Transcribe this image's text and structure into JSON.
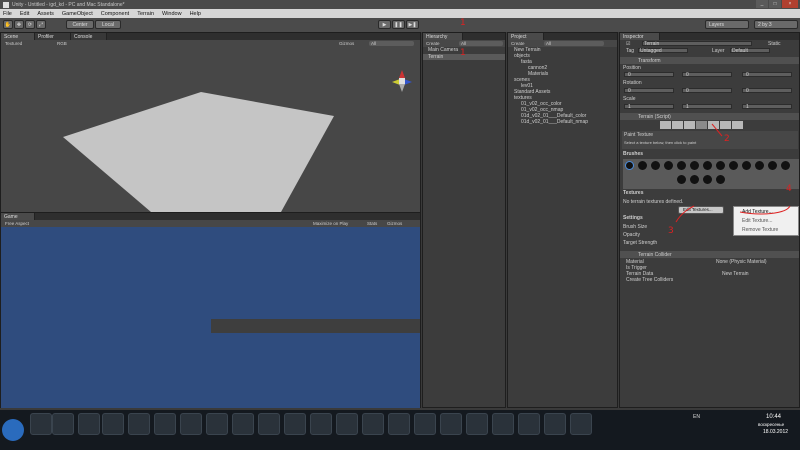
{
  "window": {
    "title": "Unity - Untitled - igd_kd - PC and Mac Standalone*",
    "controls": [
      "_",
      "□",
      "×"
    ]
  },
  "menubar": [
    "File",
    "Edit",
    "Assets",
    "GameObject",
    "Component",
    "Terrain",
    "Window",
    "Help"
  ],
  "toolbar": {
    "pivot_label": "Center",
    "space_label": "Local",
    "play_icons": [
      "▶",
      "❚❚",
      "▶❚"
    ],
    "layers_label": "Layers",
    "layout_label": "2 by 3"
  },
  "scene": {
    "tab": "Scene",
    "tab2": "Profiler",
    "tab3": "Console",
    "render_mode": "Textured",
    "color_mode": "RGB",
    "gizmos": "Gizmos",
    "search": "All"
  },
  "game": {
    "tab": "Game",
    "aspect": "Free Aspect",
    "maximize": "Maximize on Play",
    "stats": "Stats",
    "gizmos": "Gizmos"
  },
  "hierarchy": {
    "tab": "Hierarchy",
    "create": "Create",
    "search": "All",
    "items": [
      "Main Camera",
      "Terrain"
    ]
  },
  "project": {
    "tab": "Project",
    "create": "Create",
    "search": "All",
    "items": [
      {
        "label": "New Terrain",
        "indent": 0
      },
      {
        "label": "objects",
        "indent": 0
      },
      {
        "label": "fasta",
        "indent": 1
      },
      {
        "label": "cannon2",
        "indent": 2
      },
      {
        "label": "Materials",
        "indent": 2
      },
      {
        "label": "scenes",
        "indent": 0
      },
      {
        "label": "lev01",
        "indent": 1
      },
      {
        "label": "Standard Assets",
        "indent": 0
      },
      {
        "label": "textures",
        "indent": 0
      },
      {
        "label": "01_v02_occ_color",
        "indent": 1
      },
      {
        "label": "01_v02_occ_nmap",
        "indent": 1
      },
      {
        "label": "01d_v02_01___Default_color",
        "indent": 1
      },
      {
        "label": "01d_v02_01___Default_nmap",
        "indent": 1
      }
    ]
  },
  "inspector": {
    "tab": "Inspector",
    "object_name": "Terrain",
    "static": "Static",
    "tag_label": "Tag",
    "tag_value": "Untagged",
    "layer_label": "Layer",
    "layer_value": "Default",
    "transform": "Transform",
    "position": "Position",
    "rotation": "Rotation",
    "scale": "Scale",
    "pos": {
      "x": "0",
      "y": "0",
      "z": "0"
    },
    "rot": {
      "x": "0",
      "y": "0",
      "z": "0"
    },
    "scl": {
      "x": "1",
      "y": "1",
      "z": "1"
    },
    "terrain_script": "Terrain (Script)",
    "paint_texture": "Paint Texture",
    "paint_hint": "Select a texture below, then click to paint",
    "brushes": "Brushes",
    "textures": "Textures",
    "no_textures": "No terrain textures defined.",
    "edit_textures": "Edit Textures...",
    "settings": "Settings",
    "brush_size": "Brush Size",
    "opacity": "Opacity",
    "target_strength": "Target Strength",
    "collider": "Terrain Collider",
    "material": "Material",
    "material_value": "None (Physic Material)",
    "is_trigger": "Is Trigger",
    "terrain_data": "Terrain Data",
    "terrain_data_value": "New Terrain",
    "create_tree": "Create Tree Colliders"
  },
  "context_menu": [
    "Add Texture...",
    "Edit Texture...",
    "Remove Texture"
  ],
  "annotations": [
    "1",
    "2",
    "3",
    "4"
  ],
  "taskbar": {
    "lang": "EN",
    "time": "10:44",
    "day": "воскресенье",
    "date": "18.03.2012"
  },
  "colors": {
    "game_bg": "#2f4c7e",
    "scene_bg": "#474747",
    "terrain": "#c5c5c5",
    "annotation": "#dd2222"
  }
}
